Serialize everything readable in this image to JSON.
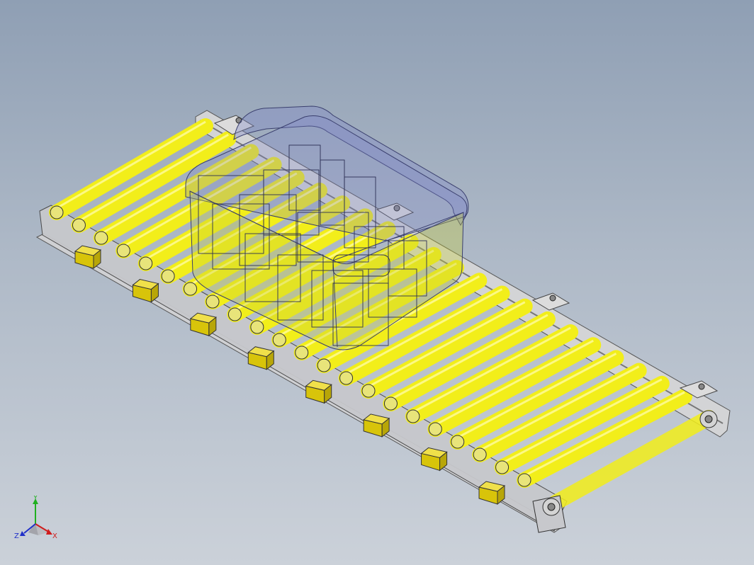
{
  "viewport": {
    "background_top": "#8f9fb4",
    "background_bottom": "#cbd1d9"
  },
  "model": {
    "roller_color": "#f2ee1a",
    "drive_block_color": "#d8c40a",
    "frame_color": "#c9c9c9",
    "tote_color": "#7f86c8",
    "roller_count": 22,
    "drive_block_count": 8
  },
  "triad": {
    "x_label": "X",
    "y_label": "Y",
    "z_label": "Z",
    "x_color": "#d01c1c",
    "y_color": "#20b020",
    "z_color": "#2030c8"
  }
}
